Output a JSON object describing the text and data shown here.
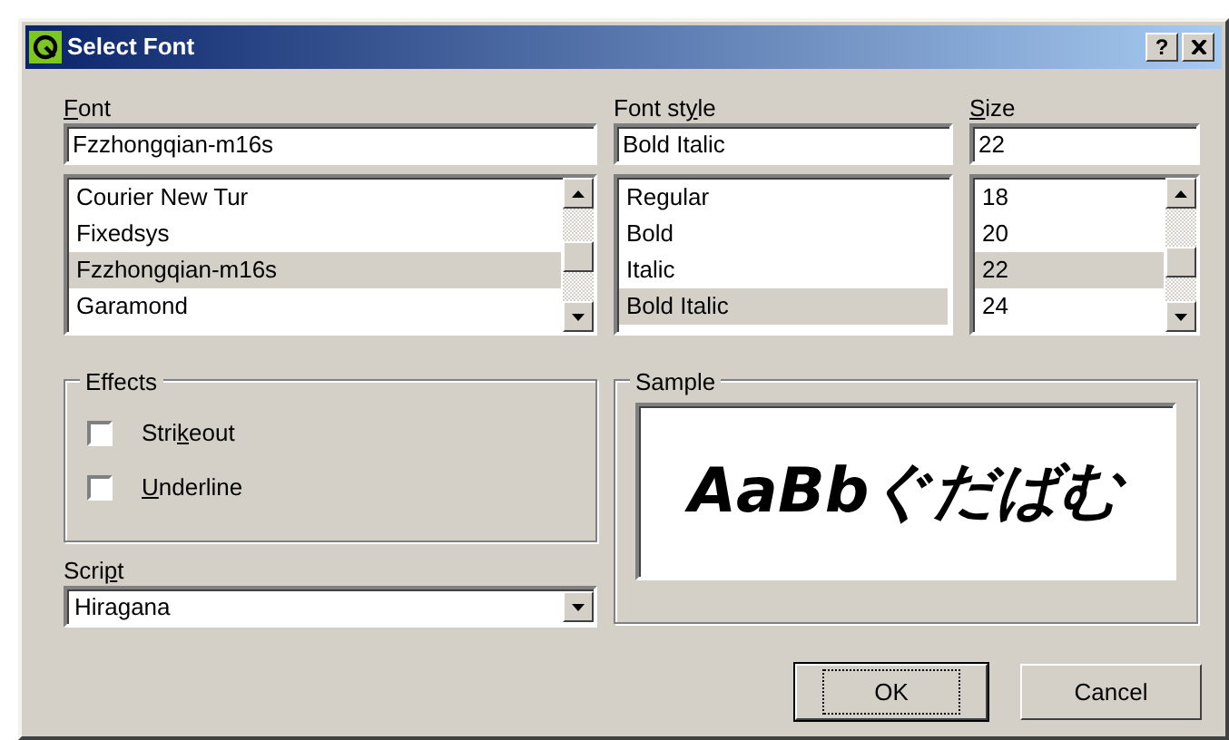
{
  "window": {
    "title": "Select Font",
    "help": "?"
  },
  "font": {
    "mnemonic": "F",
    "label_after": "ont",
    "value": "Fzzhongqian-m16s",
    "scroll": true,
    "items": [
      {
        "label": "Courier New Tur",
        "selected": false
      },
      {
        "label": "Fixedsys",
        "selected": false
      },
      {
        "label": "Fzzhongqian-m16s",
        "selected": true
      },
      {
        "label": "Garamond",
        "selected": false
      }
    ]
  },
  "style": {
    "label_before": "Font st",
    "mnemonic": "y",
    "label_after": "le",
    "value": "Bold Italic",
    "scroll": false,
    "items": [
      {
        "label": "Regular",
        "selected": false
      },
      {
        "label": "Bold",
        "selected": false
      },
      {
        "label": "Italic",
        "selected": false
      },
      {
        "label": "Bold Italic",
        "selected": true
      }
    ]
  },
  "size": {
    "mnemonic": "S",
    "label_after": "ize",
    "value": "22",
    "scroll": true,
    "items": [
      {
        "label": "18",
        "selected": false
      },
      {
        "label": "20",
        "selected": false
      },
      {
        "label": "22",
        "selected": true
      },
      {
        "label": "24",
        "selected": false
      }
    ]
  },
  "effects": {
    "label": "Effects",
    "options": [
      {
        "label_before": "Stri",
        "mnemonic": "k",
        "label_after": "eout",
        "checked": false
      },
      {
        "mnemonic": "U",
        "label_after": "nderline",
        "checked": false
      }
    ]
  },
  "script": {
    "label_before": "Scri",
    "mnemonic": "p",
    "label_after": "t",
    "value": "Hiragana"
  },
  "sample": {
    "label": "Sample",
    "text": "AaBbぐだばむ"
  },
  "buttons": [
    {
      "label": "OK",
      "default": true
    },
    {
      "label": "Cancel",
      "default": false
    }
  ]
}
